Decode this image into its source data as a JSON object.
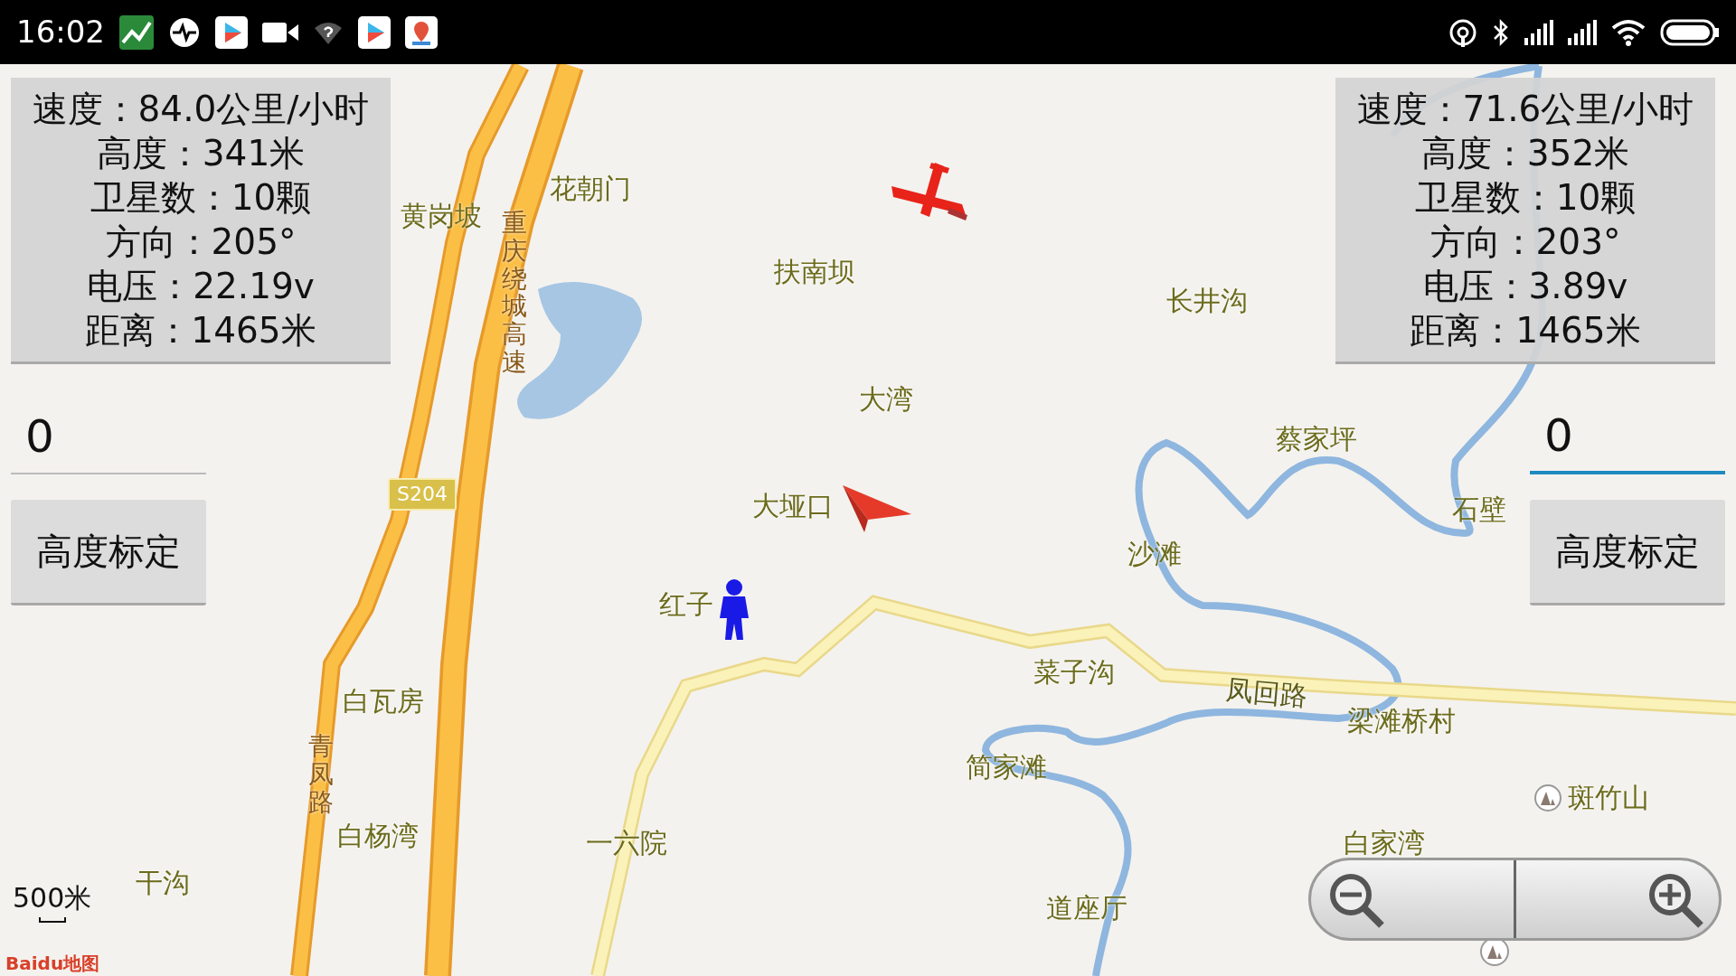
{
  "status_bar": {
    "time": "16:02"
  },
  "sides": [
    {
      "panel": [
        "速度：84.0公里/小时",
        "高度：341米",
        "卫星数：10颗",
        "方向：205°",
        "电压：22.19v",
        "距离：1465米"
      ],
      "field": {
        "value": "0",
        "focused": false
      },
      "button": "高度标定"
    },
    {
      "panel": [
        "速度：71.6公里/小时",
        "高度：352米",
        "卫星数：10颗",
        "方向：203°",
        "电压：3.89v",
        "距离：1465米"
      ],
      "field": {
        "value": "0",
        "focused": true
      },
      "button": "高度标定"
    }
  ],
  "map": {
    "labels": [
      {
        "text": "花朝门",
        "kind": "place"
      },
      {
        "text": "黄岗坡",
        "kind": "place"
      },
      {
        "text": "重庆绕城高速",
        "kind": "road_vertical"
      },
      {
        "text": "扶南坝",
        "kind": "place"
      },
      {
        "text": "长井沟",
        "kind": "place"
      },
      {
        "text": "大湾",
        "kind": "place"
      },
      {
        "text": "蔡家坪",
        "kind": "place"
      },
      {
        "text": "S204",
        "kind": "shield"
      },
      {
        "text": "大垭口",
        "kind": "place"
      },
      {
        "text": "石壁",
        "kind": "place"
      },
      {
        "text": "沙滩",
        "kind": "place"
      },
      {
        "text": "红子",
        "kind": "place"
      },
      {
        "text": "菜子沟",
        "kind": "place"
      },
      {
        "text": "凤回路",
        "kind": "road"
      },
      {
        "text": "白瓦房",
        "kind": "place"
      },
      {
        "text": "梁滩桥村",
        "kind": "place"
      },
      {
        "text": "青凤路",
        "kind": "road_vertical"
      },
      {
        "text": "简家滩",
        "kind": "place"
      },
      {
        "text": "斑竹山",
        "kind": "peak"
      },
      {
        "text": "白杨湾",
        "kind": "place"
      },
      {
        "text": "一六院",
        "kind": "place"
      },
      {
        "text": "白家湾",
        "kind": "place"
      },
      {
        "text": "干沟",
        "kind": "place"
      },
      {
        "text": "道座厅",
        "kind": "place"
      }
    ],
    "scale": "500米",
    "logo": "Baidu地图"
  }
}
